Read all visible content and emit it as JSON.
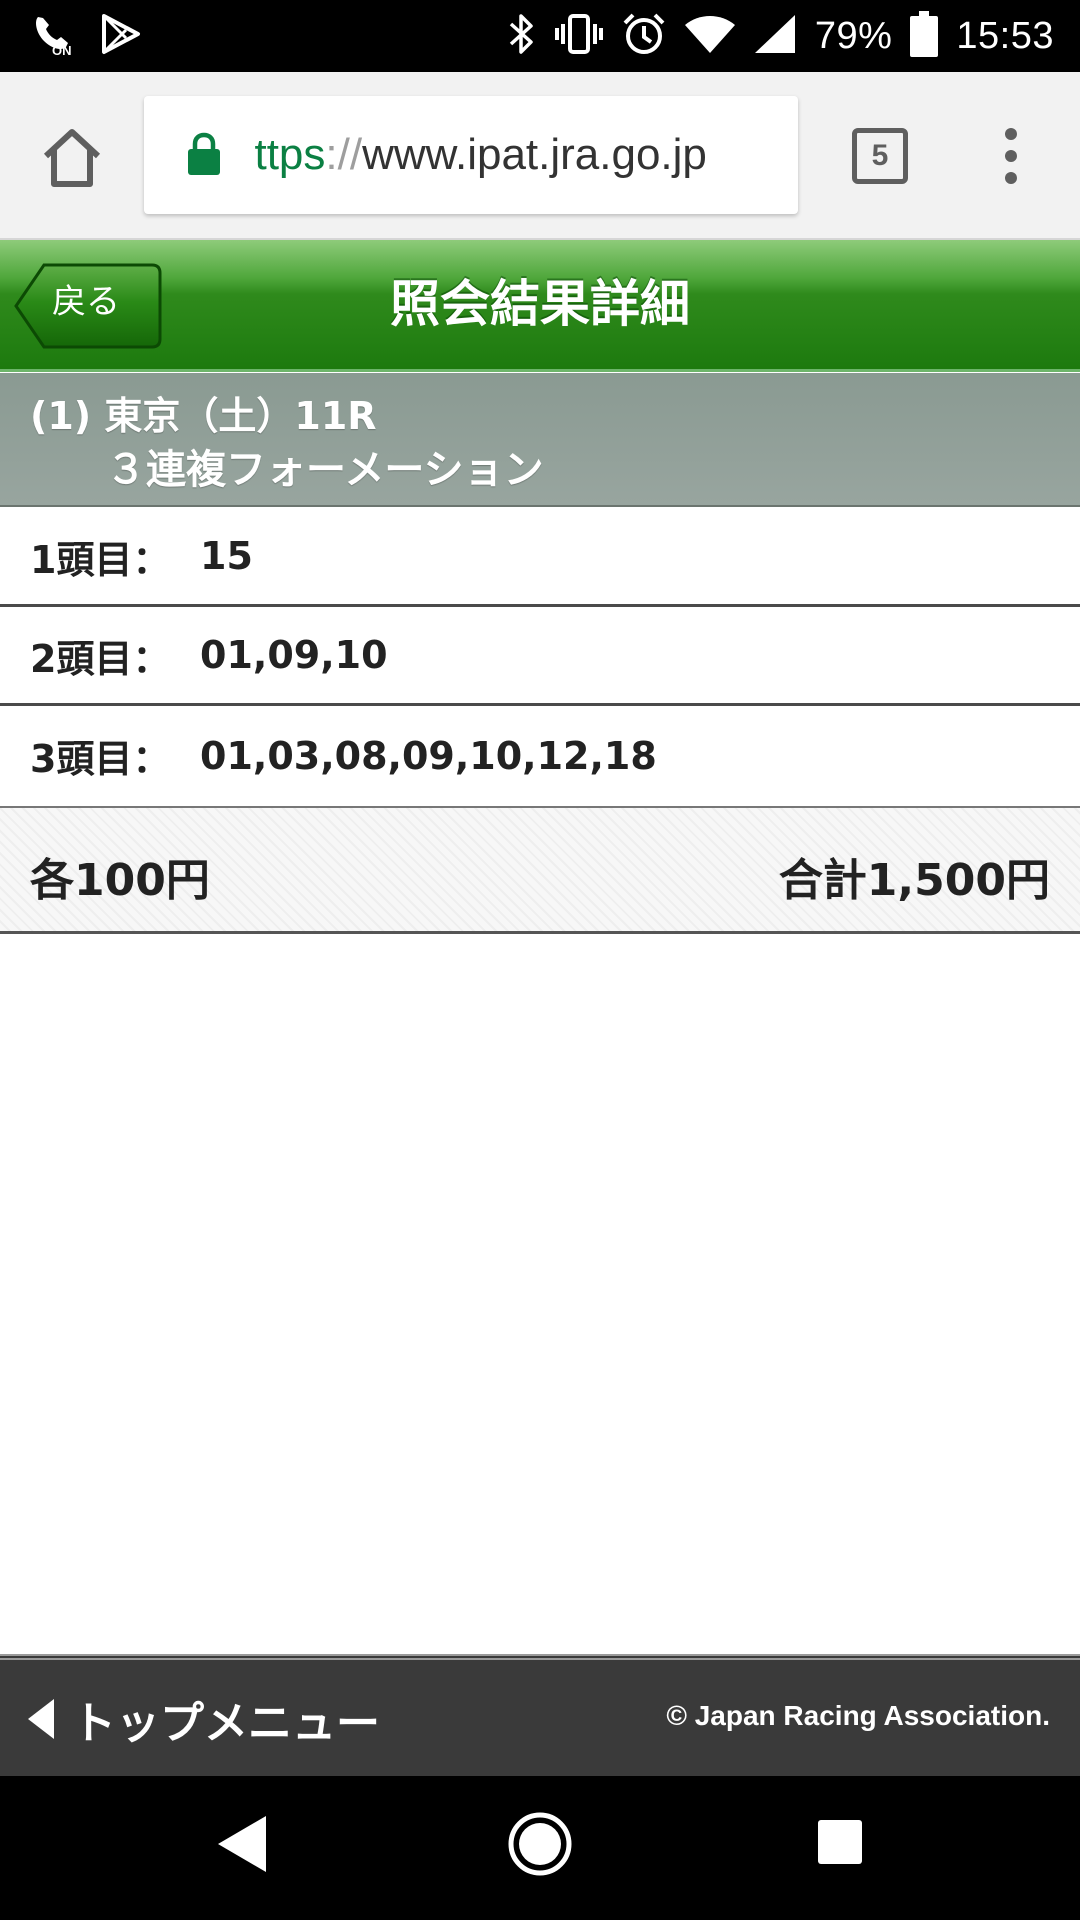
{
  "status_bar": {
    "battery_percent": "79%",
    "time": "15:53",
    "icons": [
      "call-on-icon",
      "play-store-icon",
      "bluetooth-icon",
      "vibrate-icon",
      "alarm-icon",
      "wifi-icon",
      "signal-icon",
      "battery-icon"
    ]
  },
  "browser": {
    "url_scheme": "https",
    "url_separator": "://",
    "url_host": "www.ipat.jra.go.jp",
    "tab_count": "5"
  },
  "header": {
    "back_label": "戻る",
    "title": "照会結果詳細"
  },
  "race": {
    "line1": "(1) 東京（土）11R",
    "line2": "３連複フォーメーション"
  },
  "selections": [
    {
      "label": "1頭目：",
      "value": "15"
    },
    {
      "label": "2頭目：",
      "value": "01,09,10"
    },
    {
      "label": "3頭目：",
      "value": "01,03,08,09,10,12,18"
    }
  ],
  "amount": {
    "unit": "各100円",
    "total": "合計1,500円"
  },
  "footer": {
    "menu_label": "トップメニュー",
    "copyright": "© Japan Racing Association."
  },
  "colors": {
    "header_green": "#1d7a0e",
    "race_header_gray": "#8a9a92",
    "footer_dark": "#3a3a3a",
    "url_green": "#0b8043"
  }
}
